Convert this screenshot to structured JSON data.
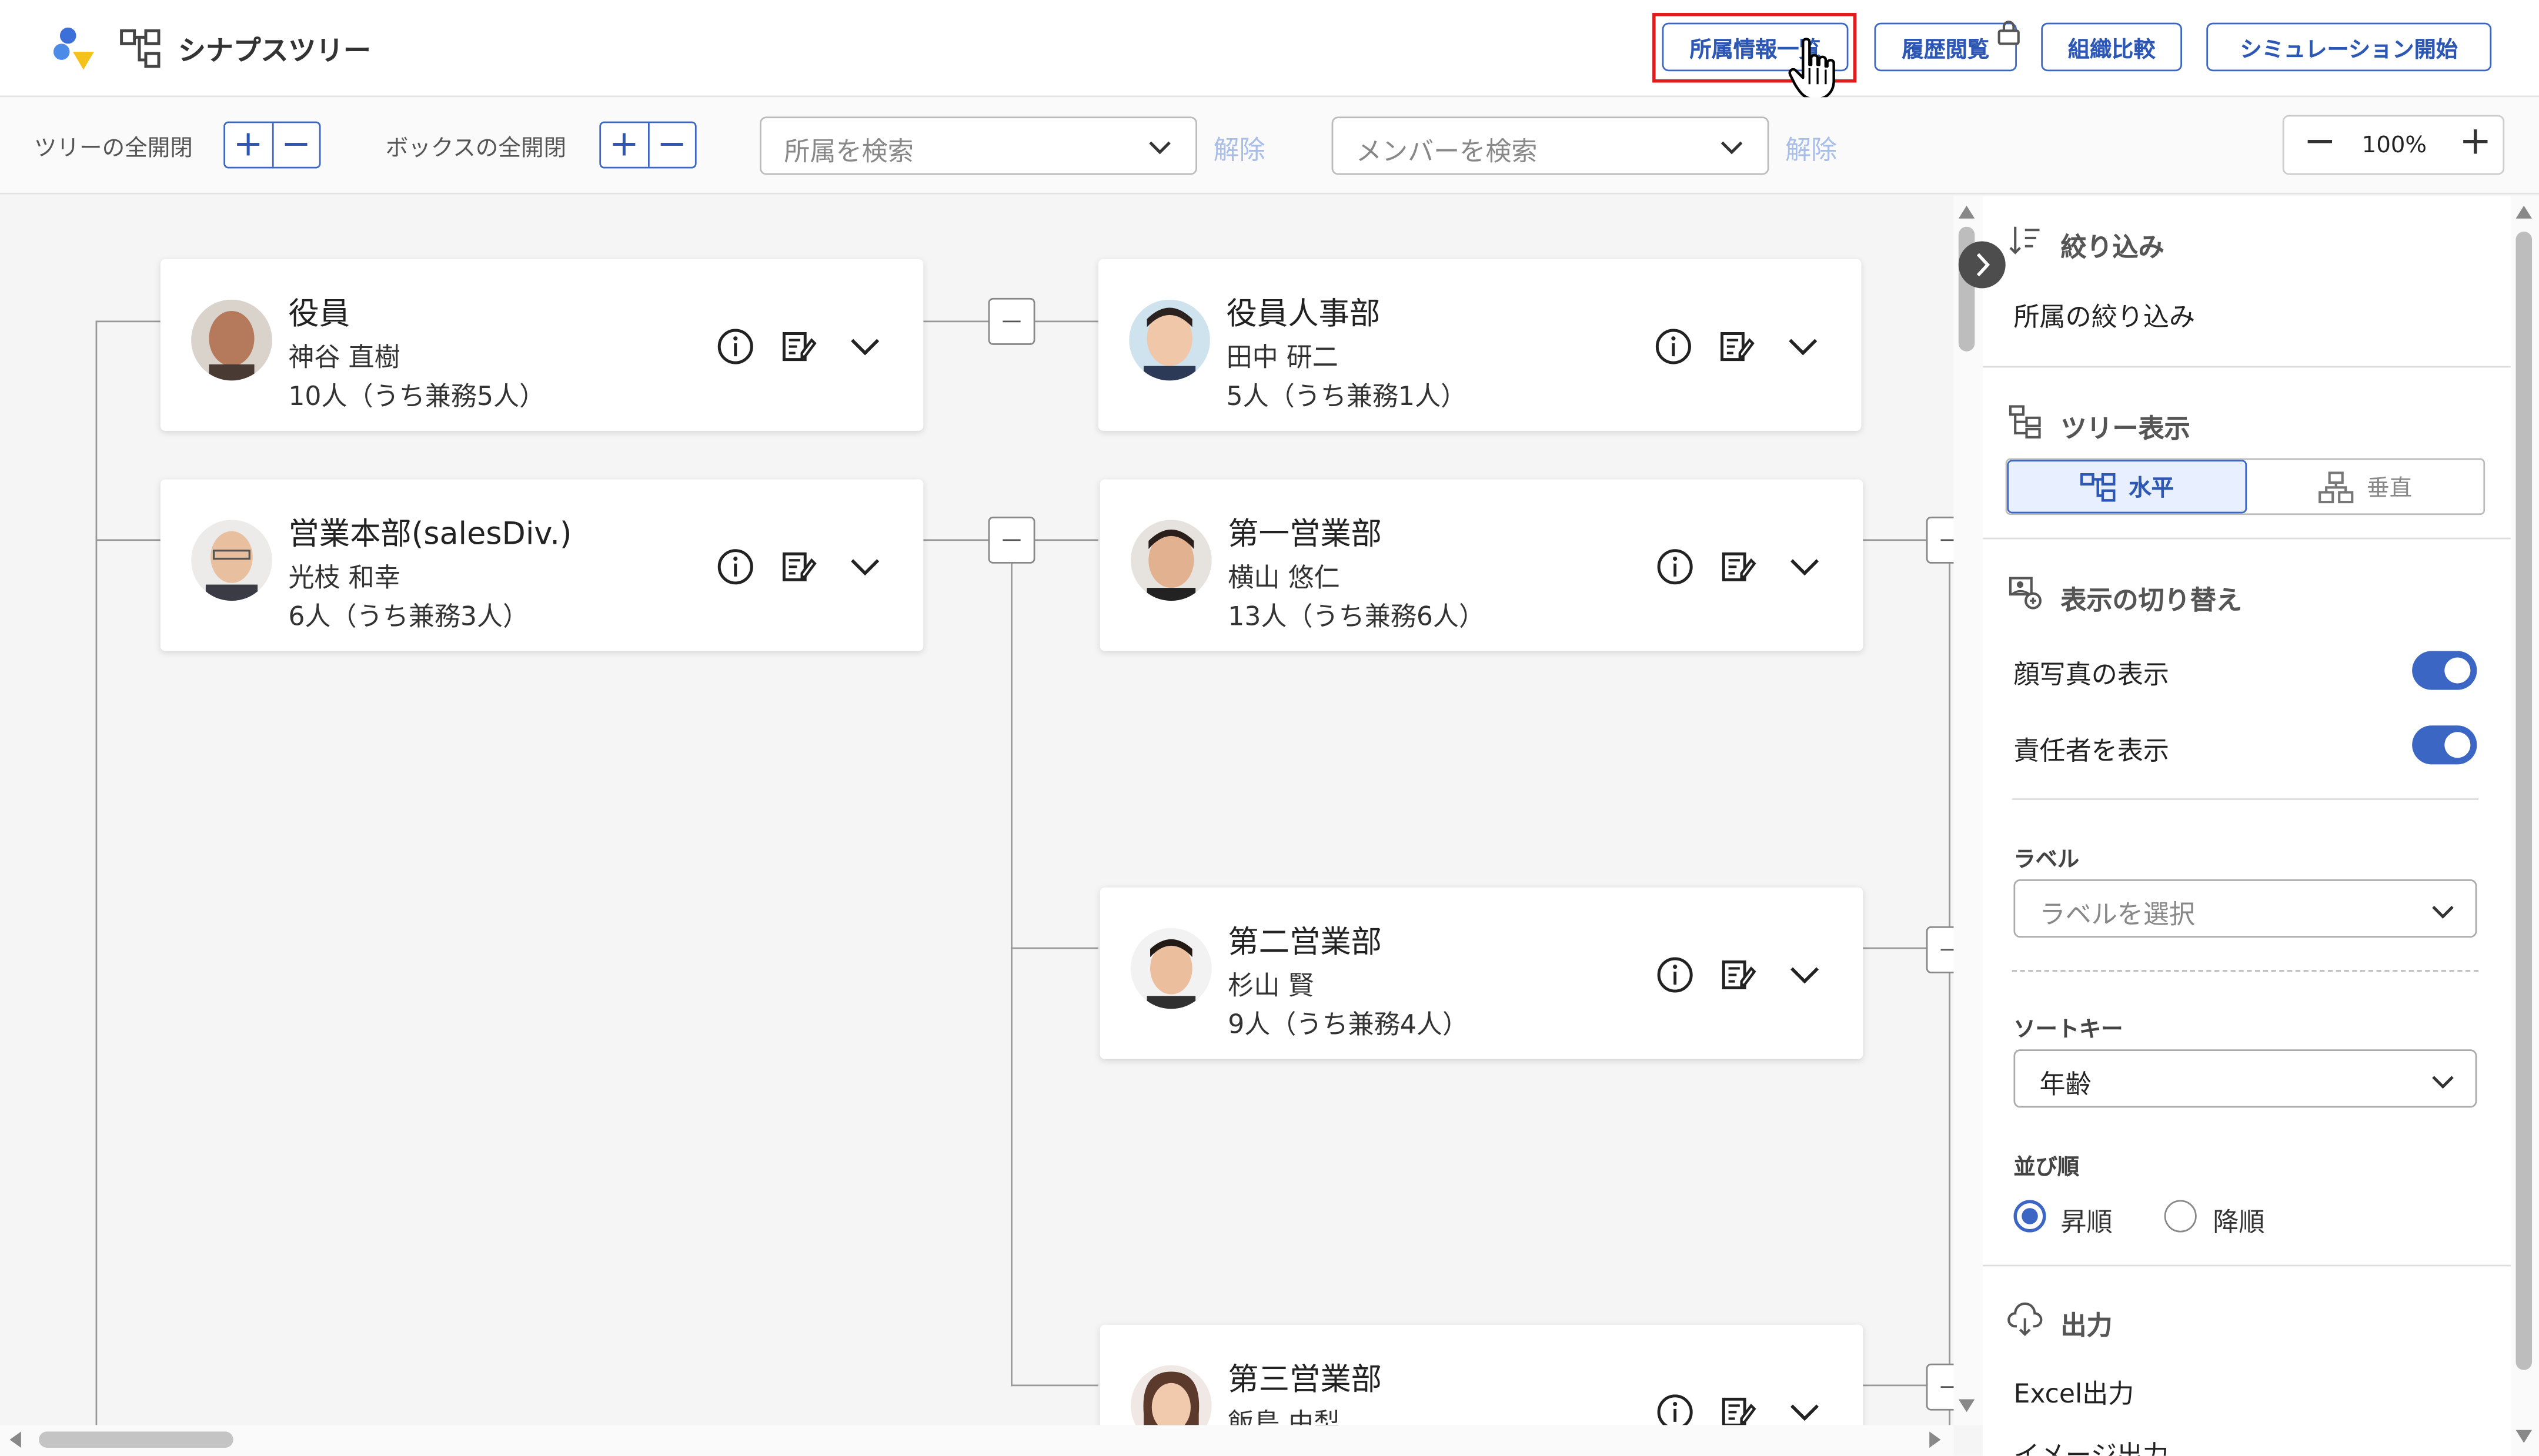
{
  "header": {
    "app_title": "シナプスツリー",
    "buttons": {
      "affiliation_list": "所属情報一覧",
      "history": "履歴閲覧",
      "compare": "組織比較",
      "simulation": "シミュレーション開始"
    }
  },
  "toolbar": {
    "tree_expand_label": "ツリーの全開閉",
    "box_expand_label": "ボックスの全開閉",
    "plus": "+",
    "minus": "−",
    "affiliation_search_placeholder": "所属を検索",
    "member_search_placeholder": "メンバーを検索",
    "clear_label": "解除",
    "zoom_value": "100%",
    "zoom_out": "−",
    "zoom_in": "+"
  },
  "nodes": [
    {
      "name": "役員",
      "manager": "神谷 直樹",
      "count": "10人（うち兼務5人）"
    },
    {
      "name": "営業本部(salesDiv.)",
      "manager": "光枝 和幸",
      "count": "6人（うち兼務3人）"
    },
    {
      "name": "役員人事部",
      "manager": "田中 研二",
      "count": "5人（うち兼務1人）"
    },
    {
      "name": "第一営業部",
      "manager": "横山 悠仁",
      "count": "13人（うち兼務6人）"
    },
    {
      "name": "第二営業部",
      "manager": "杉山 賢",
      "count": "9人（うち兼務4人）"
    },
    {
      "name": "第三営業部",
      "manager": "飯島 由梨",
      "count": ""
    }
  ],
  "panel": {
    "filter": {
      "title": "絞り込み",
      "item": "所属の絞り込み"
    },
    "tree_view": {
      "title": "ツリー表示",
      "horizontal": "水平",
      "vertical": "垂直"
    },
    "display": {
      "title": "表示の切り替え",
      "show_photo": "顔写真の表示",
      "show_manager": "責任者を表示",
      "show_photo_on": true,
      "show_manager_on": true
    },
    "label": {
      "title": "ラベル",
      "placeholder": "ラベルを選択"
    },
    "sort_key": {
      "title": "ソートキー",
      "value": "年齢"
    },
    "order": {
      "title": "並び順",
      "asc": "昇順",
      "desc": "降順",
      "selected": "asc"
    },
    "output": {
      "title": "出力",
      "excel": "Excel出力",
      "image": "イメージ出力"
    }
  },
  "colors": {
    "accent": "#3b66c4",
    "highlight": "#e01b1b"
  }
}
